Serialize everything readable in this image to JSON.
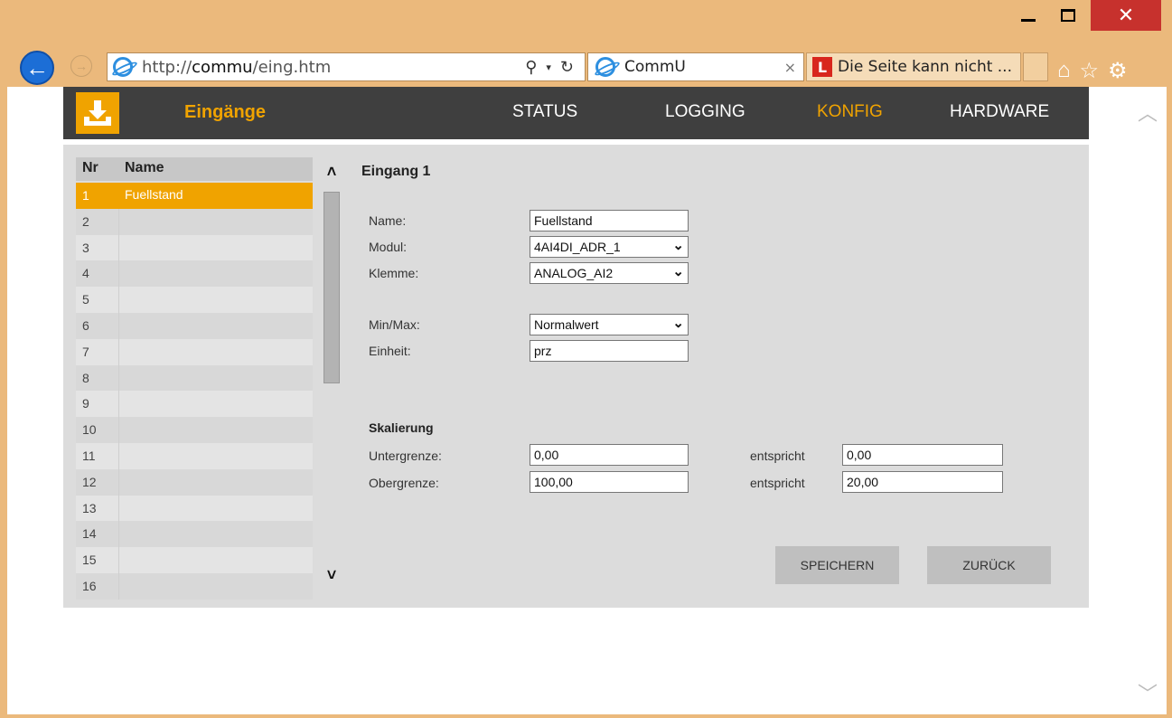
{
  "browser": {
    "url_prefix": "http://",
    "url_host": "commu",
    "url_path": "/eing.htm",
    "tab1_title": "CommU",
    "tab1_close": "×",
    "tab2_title": "Die Seite kann nicht ...",
    "tab2_badge": "L"
  },
  "app": {
    "title": "Eingänge",
    "nav": [
      {
        "label": "STATUS",
        "active": false
      },
      {
        "label": "LOGGING",
        "active": false
      },
      {
        "label": "KONFIG",
        "active": true
      },
      {
        "label": "HARDWARE",
        "active": false
      }
    ],
    "accent_color": "#f0a300"
  },
  "list": {
    "headers": {
      "nr": "Nr",
      "name": "Name"
    },
    "rows": [
      {
        "nr": "1",
        "name": "Fuellstand",
        "selected": true
      },
      {
        "nr": "2",
        "name": ""
      },
      {
        "nr": "3",
        "name": ""
      },
      {
        "nr": "4",
        "name": ""
      },
      {
        "nr": "5",
        "name": ""
      },
      {
        "nr": "6",
        "name": ""
      },
      {
        "nr": "7",
        "name": ""
      },
      {
        "nr": "8",
        "name": ""
      },
      {
        "nr": "9",
        "name": ""
      },
      {
        "nr": "10",
        "name": ""
      },
      {
        "nr": "11",
        "name": ""
      },
      {
        "nr": "12",
        "name": ""
      },
      {
        "nr": "13",
        "name": ""
      },
      {
        "nr": "14",
        "name": ""
      },
      {
        "nr": "15",
        "name": ""
      },
      {
        "nr": "16",
        "name": ""
      }
    ]
  },
  "form": {
    "title": "Eingang 1",
    "name_label": "Name:",
    "name_value": "Fuellstand",
    "modul_label": "Modul:",
    "modul_value": "4AI4DI_ADR_1",
    "klemme_label": "Klemme:",
    "klemme_value": "ANALOG_AI2",
    "minmax_label": "Min/Max:",
    "minmax_value": "Normalwert",
    "einheit_label": "Einheit:",
    "einheit_value": "prz",
    "skalierung_label": "Skalierung",
    "unter_label": "Untergrenze:",
    "unter_value": "0,00",
    "ober_label": "Obergrenze:",
    "ober_value": "100,00",
    "entspricht_label": "entspricht",
    "unter_entspricht_value": "0,00",
    "ober_entspricht_value": "20,00",
    "save_label": "SPEICHERN",
    "back_label": "ZURÜCK"
  }
}
